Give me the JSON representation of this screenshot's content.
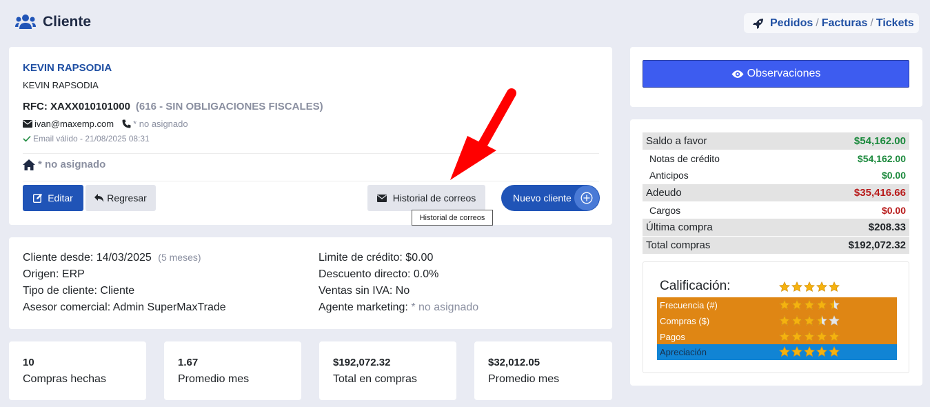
{
  "header": {
    "title": "Cliente"
  },
  "breadcrumbs": {
    "pedidos": "Pedidos",
    "facturas": "Facturas",
    "tickets": "Tickets",
    "separator": "/"
  },
  "client": {
    "name": "KEVIN RAPSODIA",
    "business_name": "KEVIN RAPSODIA",
    "rfc": "RFC: XAXX010101000",
    "regime": "(616 - SIN OBLIGACIONES FISCALES)",
    "email": "ivan@maxemp.com",
    "phone": "* no asignado",
    "email_valid": "Email válido - 21/08/2025 08:31",
    "address": "* no asignado"
  },
  "actions": {
    "edit_label": "Editar",
    "back_label": "Regresar",
    "email_history_label": "Historial de correos",
    "new_client_label": "Nuevo cliente",
    "tooltip": "Historial de correos"
  },
  "details": {
    "since_label": "Cliente desde:",
    "since_value": "14/03/2025",
    "since_age": "(5 meses)",
    "origin_label": "Origen:",
    "origin_value": "ERP",
    "type_label": "Tipo de cliente:",
    "type_value": "Cliente",
    "advisor_label": "Asesor comercial:",
    "advisor_value": "Admin SuperMaxTrade",
    "credit_label": "Limite de crédito:",
    "credit_value": "$0.00",
    "discount_label": "Descuento directo:",
    "discount_value": "0.0%",
    "noiva_label": "Ventas sin IVA:",
    "noiva_value": "No",
    "agent_label": "Agente marketing:",
    "agent_value": "* no asignado"
  },
  "stats": [
    {
      "value": "10",
      "label": "Compras hechas"
    },
    {
      "value": "1.67",
      "label": "Promedio mes"
    },
    {
      "value": "$192,072.32",
      "label": "Total en compras"
    },
    {
      "value": "$32,012.05",
      "label": "Promedio mes"
    }
  ],
  "observations": {
    "label": "Observaciones"
  },
  "balance": [
    {
      "label": "Saldo a favor",
      "value": "$54,162.00",
      "color": "#1d8a3e"
    },
    {
      "label": "Notas de crédito",
      "value": "$54,162.00",
      "color": "#1d8a3e"
    },
    {
      "label": "Anticipos",
      "value": "$0.00",
      "color": "#1d8a3e"
    },
    {
      "label": "Adeudo",
      "value": "$35,416.66",
      "color": "#b81a1a"
    },
    {
      "label": "Cargos",
      "value": "$0.00",
      "color": "#b81a1a"
    },
    {
      "label": "Última compra",
      "value": "$208.33",
      "color": "#212529"
    },
    {
      "label": "Total compras",
      "value": "$192,072.32",
      "color": "#212529"
    }
  ],
  "rating": {
    "title": "Calificación:",
    "overall_stars": 5,
    "rows": [
      {
        "label": "Frecuencia (#)",
        "stars": 4.5
      },
      {
        "label": "Compras ($)",
        "stars": 3.5
      },
      {
        "label": "Pagos",
        "stars": 5
      },
      {
        "label": "Apreciación",
        "stars": 5
      }
    ]
  },
  "colors": {
    "primary": "#2054b7",
    "observations": "#3d5cf0",
    "rating_orange": "#df8614",
    "rating_blue": "#1184d4",
    "arrow": "#ff0000"
  }
}
